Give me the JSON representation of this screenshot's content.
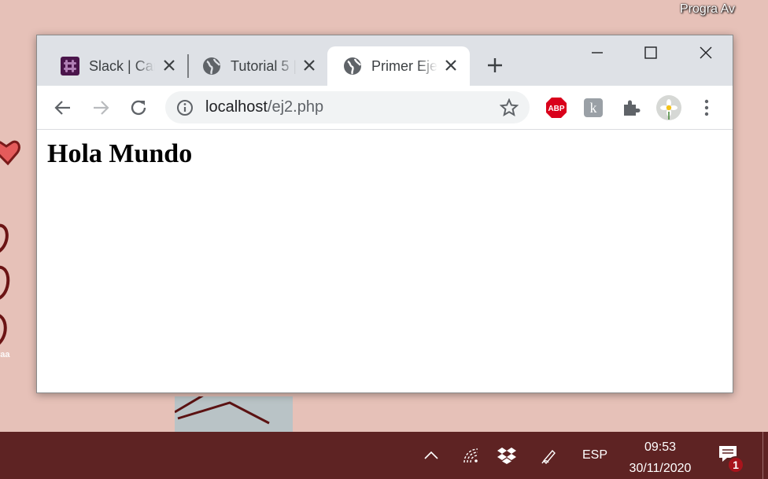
{
  "desktop": {
    "label": "Progra Av",
    "wallpaper_text": "raa"
  },
  "browser": {
    "tabs": [
      {
        "title": "Slack | Canal",
        "icon": "slack-icon"
      },
      {
        "title": "Tutorial 5 |",
        "icon": "globe-icon"
      },
      {
        "title": "Primer Ejemplo",
        "icon": "globe-icon",
        "active": true
      }
    ],
    "address": {
      "host": "localhost",
      "path": "/ej2.php"
    },
    "extensions": [
      "adblock-plus-icon",
      "kami-icon",
      "extensions-puzzle-icon",
      "profile-avatar"
    ],
    "extension_labels": {
      "abp": "ABP",
      "kami": "k"
    }
  },
  "page": {
    "heading": "Hola Mundo"
  },
  "taskbar": {
    "language": "ESP",
    "time": "09:53",
    "date": "30/11/2020",
    "notification_count": "1"
  },
  "colors": {
    "taskbar": "#5e2323",
    "tabstrip": "#dee1e6",
    "abp_red": "#d9001b",
    "badge": "#a8141c"
  }
}
